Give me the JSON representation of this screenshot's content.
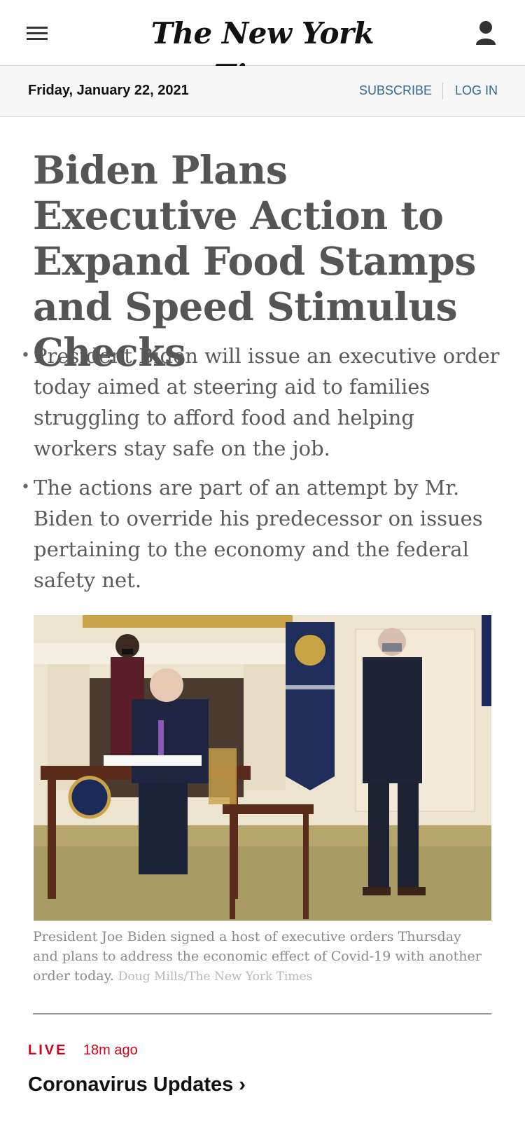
{
  "masthead": {
    "logo_text": "The New York Times",
    "menu_icon": "hamburger-menu-icon",
    "account_icon": "user-icon"
  },
  "datebar": {
    "date": "Friday, January 22, 2021",
    "subscribe_label": "SUBSCRIBE",
    "login_label": "LOG IN"
  },
  "article": {
    "headline": "Biden Plans Executive Action to Expand Food Stamps and Speed Stimulus Checks",
    "summary": [
      "President Biden will issue an executive order today aimed at steering aid to families struggling to afford food and helping workers stay safe on the job.",
      "The actions are part of an attempt by Mr. Biden to override his predecessor on issues pertaining to the economy and the federal safety net."
    ],
    "image_caption": "President Joe Biden signed a host of executive orders Thursday and plans to address the economic effect of Covid-19 with another order today.",
    "image_credit": "Doug Mills/The New York Times"
  },
  "live": {
    "label": "LIVE",
    "time_ago": "18m ago",
    "title": "Coronavirus Updates",
    "chevron": "›"
  },
  "colors": {
    "link_blue": "#326891",
    "live_red": "#d0021b",
    "headline_gray": "#555555"
  }
}
